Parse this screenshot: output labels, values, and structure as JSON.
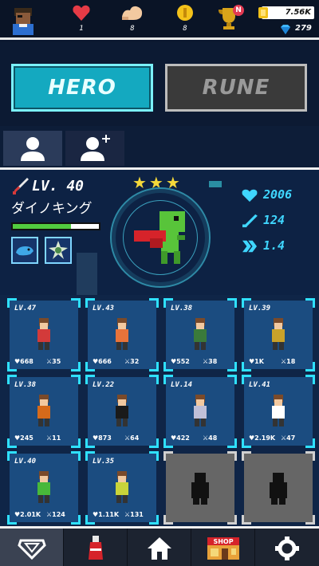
{
  "top": {
    "stats": [
      {
        "icon": "heart-icon",
        "value": "1"
      },
      {
        "icon": "muscle-icon",
        "value": "8"
      },
      {
        "icon": "coin-icon",
        "value": "8"
      }
    ],
    "notification_badge": "N",
    "gold": "7.56K",
    "gems": "279"
  },
  "tabs": {
    "hero": "HERO",
    "rune": "RUNE"
  },
  "hero": {
    "level": "LV. 40",
    "name": "ダイノキング",
    "xp_fraction": 0.68,
    "stars": "★★★",
    "hp": "2006",
    "attack": "124",
    "speed": "1.4"
  },
  "heroes": [
    {
      "level": "LV.47",
      "hp": "668",
      "atk": "35",
      "color": "#d33a3a",
      "locked": false
    },
    {
      "level": "LV.43",
      "hp": "666",
      "atk": "32",
      "color": "#e8733a",
      "locked": false
    },
    {
      "level": "LV.38",
      "hp": "552",
      "atk": "38",
      "color": "#3a7a3a",
      "locked": false
    },
    {
      "level": "LV.39",
      "hp": "1K",
      "atk": "18",
      "color": "#c9a22a",
      "locked": false
    },
    {
      "level": "LV.38",
      "hp": "245",
      "atk": "11",
      "color": "#d66a1a",
      "locked": false
    },
    {
      "level": "LV.22",
      "hp": "873",
      "atk": "64",
      "color": "#1a1a1a",
      "locked": false
    },
    {
      "level": "LV.14",
      "hp": "422",
      "atk": "48",
      "color": "#c0c0d8",
      "locked": false
    },
    {
      "level": "LV.41",
      "hp": "2.19K",
      "atk": "47",
      "color": "#ffffff",
      "locked": false
    },
    {
      "level": "LV.40",
      "hp": "2.01K",
      "atk": "124",
      "color": "#48b83a",
      "locked": false
    },
    {
      "level": "LV.35",
      "hp": "1.11K",
      "atk": "131",
      "color": "#c9d43a",
      "locked": false
    },
    {
      "level": "",
      "hp": "",
      "atk": "",
      "color": "#111111",
      "locked": true
    },
    {
      "level": "",
      "hp": "",
      "atk": "",
      "color": "#111111",
      "locked": true
    }
  ],
  "nav": {
    "shop_label": "SHOP"
  }
}
